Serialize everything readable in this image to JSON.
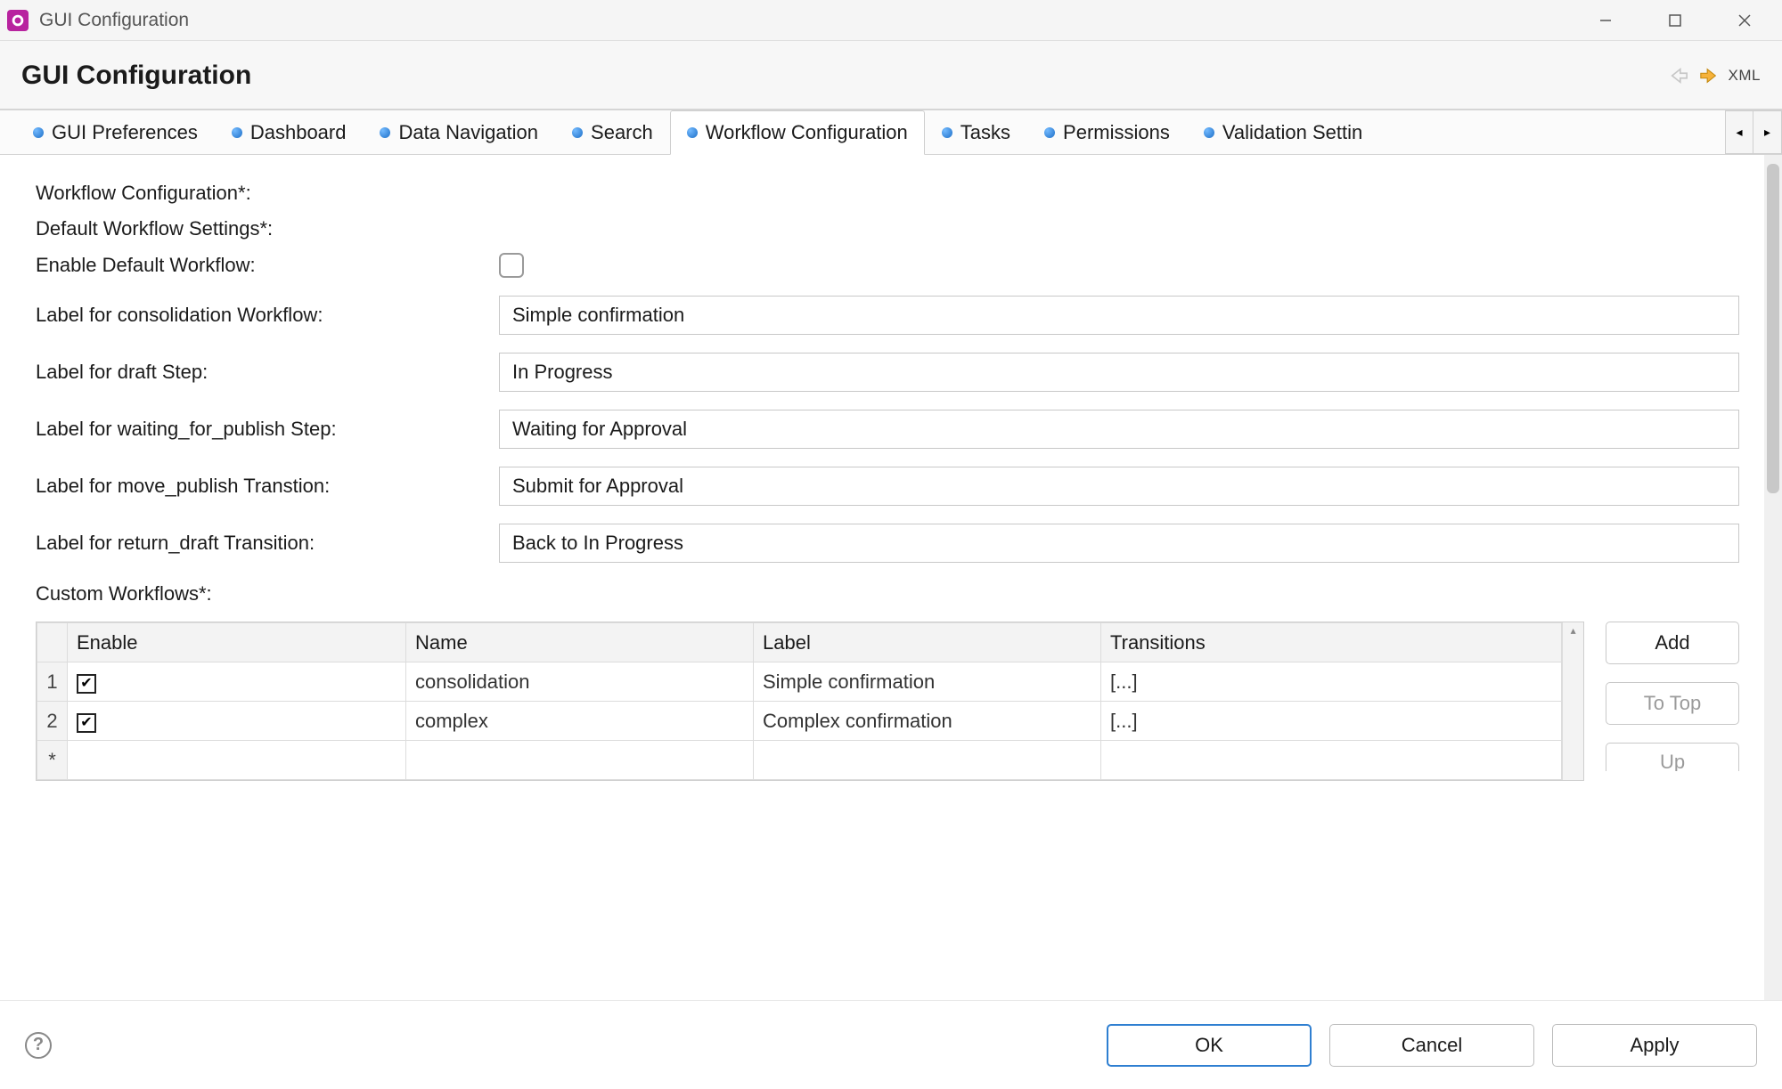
{
  "window": {
    "title": "GUI Configuration"
  },
  "banner": {
    "title": "GUI Configuration",
    "xml": "XML"
  },
  "tabs": [
    {
      "label": "GUI Preferences",
      "active": false
    },
    {
      "label": "Dashboard",
      "active": false
    },
    {
      "label": "Data Navigation",
      "active": false
    },
    {
      "label": "Search",
      "active": false
    },
    {
      "label": "Workflow Configuration",
      "active": true
    },
    {
      "label": "Tasks",
      "active": false
    },
    {
      "label": "Permissions",
      "active": false
    },
    {
      "label": "Validation Settin",
      "active": false
    }
  ],
  "labels": {
    "workflow_config": "Workflow Configuration*:",
    "default_settings": "Default Workflow Settings*:",
    "enable_default": "Enable Default Workflow:",
    "label_consolidation": "Label for consolidation Workflow:",
    "label_draft": "Label for draft Step:",
    "label_waiting": "Label for waiting_for_publish Step:",
    "label_move_publish": "Label for move_publish Transtion:",
    "label_return_draft": "Label for return_draft Transition:",
    "custom_workflows": "Custom Workflows*:"
  },
  "fields": {
    "enable_default_workflow": false,
    "consolidation_workflow": "Simple confirmation",
    "draft_step": "In Progress",
    "waiting_for_publish_step": "Waiting for Approval",
    "move_publish_transition": "Submit for Approval",
    "return_draft_transition": "Back to In Progress"
  },
  "table": {
    "headers": {
      "enable": "Enable",
      "name": "Name",
      "label": "Label",
      "transitions": "Transitions"
    },
    "rows": [
      {
        "num": "1",
        "enable": true,
        "name": "consolidation",
        "label": "Simple confirmation",
        "transitions": "[...]"
      },
      {
        "num": "2",
        "enable": true,
        "name": "complex",
        "label": "Complex confirmation",
        "transitions": "[...]"
      }
    ],
    "new_row_marker": "*"
  },
  "side_buttons": {
    "add": "Add",
    "to_top": "To Top",
    "up": "Up"
  },
  "footer": {
    "ok": "OK",
    "cancel": "Cancel",
    "apply": "Apply"
  }
}
